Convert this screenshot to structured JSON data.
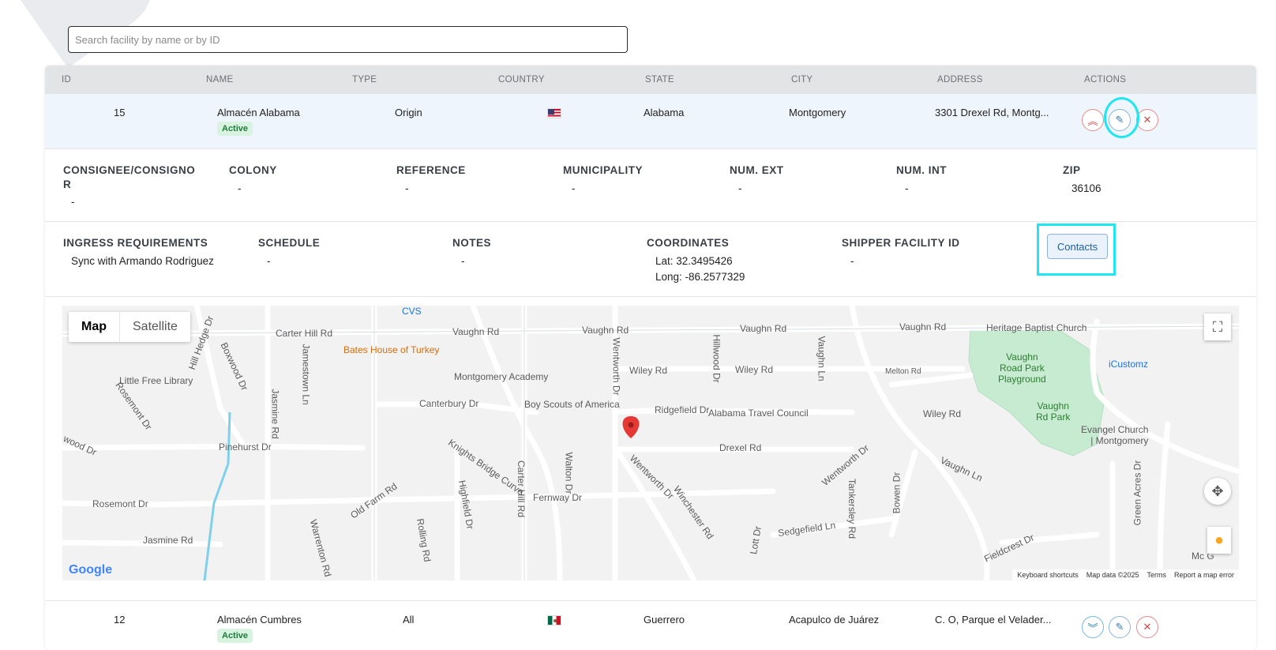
{
  "search": {
    "placeholder": "Search facility by name or by ID"
  },
  "columns": [
    "ID",
    "NAME",
    "TYPE",
    "COUNTRY",
    "STATE",
    "CITY",
    "ADDRESS",
    "ACTIONS"
  ],
  "rows": [
    {
      "id": "15",
      "name": "Almacén Alabama",
      "status": "Active",
      "type": "Origin",
      "country_flag": "us-flag",
      "state": "Alabama",
      "city": "Montgomery",
      "address": "3301 Drexel Rd, Montg..."
    },
    {
      "id": "12",
      "name": "Almacén Cumbres",
      "status": "Active",
      "type": "All",
      "country_flag": "mx-flag",
      "state": "Guerrero",
      "city": "Acapulco de Juárez",
      "address": "C. O, Parque el Velader..."
    }
  ],
  "details": {
    "labels1": [
      "CONSIGNEE/CONSIGNO",
      "R",
      "COLONY",
      "REFERENCE",
      "MUNICIPALITY",
      "NUM. EXT",
      "NUM. INT",
      "ZIP"
    ],
    "values1": [
      "-",
      "-",
      "-",
      "-",
      "-",
      "-",
      "36106"
    ],
    "labels2": [
      "INGRESS REQUIREMENTS",
      "SCHEDULE",
      "NOTES",
      "COORDINATES",
      "SHIPPER FACILITY ID"
    ],
    "ingress": "Sync with Armando Rodriguez",
    "schedule": "-",
    "notes": "-",
    "lat": "Lat: 32.3495426",
    "long": "Long: -86.2577329",
    "shipper_id": "-",
    "contacts_label": "Contacts"
  },
  "map": {
    "toggle": [
      "Map",
      "Satellite"
    ],
    "labels": {
      "cvs": "CVS",
      "carter_hill_rd": "Carter Hill Rd",
      "vaughn_rd_1": "Vaughn Rd",
      "vaughn_rd_2": "Vaughn Rd",
      "vaughn_rd_3": "Vaughn Rd",
      "vaughn_rd_4": "Vaughn Rd",
      "heritage": "Heritage Baptist Church",
      "bates": "Bates House of Turkey",
      "montgomery_academy": "Montgomery Academy",
      "little_free_library": "Little Free Library",
      "wiley_rd_1": "Wiley Rd",
      "wiley_rd_2": "Wiley Rd",
      "wiley_rd_3": "Wiley Rd",
      "melton_rd": "Melton Rd",
      "vaughn_park_1": "Vaughn",
      "vaughn_park_2": "Road Park",
      "vaughn_park_3": "Playground",
      "icustomz": "iCustomz",
      "canterbury_dr": "Canterbury Dr",
      "boy_scouts": "Boy Scouts of America",
      "ridgefield": "Ridgefield Dr",
      "alabama_travel": "Alabama Travel Council",
      "vaughn_rd_park_1": "Vaughn",
      "vaughn_rd_park_2": "Rd Park",
      "evangel_1": "Evangel Church",
      "evangel_2": "| Montgomery",
      "pinehurst": "Pinehurst Dr",
      "drexel": "Drexel Rd",
      "knights_bridge": "Knights Bridge Curve",
      "rosemont_dr": "Rosemont Dr",
      "fernway": "Fernway Dr",
      "sedgefield": "Sedgefield Ln",
      "fieldcrest": "Fieldcrest Dr",
      "jasmine_rd": "Jasmine Rd",
      "old_farm": "Old Farm Rd",
      "wentworth": "Wentworth Dr",
      "winchester": "Winchester Rd",
      "rosemont_vertical": "Rosemont Dr",
      "hill_hedge": "Hill Hedge Dr",
      "boxwood": "Boxwood Dr",
      "jamestown": "Jamestown Ln",
      "jasmine_vert": "Jasmine Rd",
      "highfield": "Highfield Dr",
      "carter_vert": "Carter Hill Rd",
      "walton": "Walton Dr",
      "wentworth_vert": "Wentworth Dr",
      "hillwood": "Hillwood Dr",
      "vaughn_ln": "Vaughn Ln",
      "vaughn_ln_2": "Vaughn Ln",
      "tankersley": "Tankersley Rd",
      "bowen": "Bowen Dr",
      "green_acres": "Green Acres Dr",
      "lott": "Lott Dr",
      "rolling": "Rolling Rd",
      "warrenton": "Warrenton Rd",
      "wood_dr": "wood Dr",
      "wentworth_dr_2": "Wentworth Dr",
      "mc": "Mc G"
    },
    "footer": [
      "Keyboard shortcuts",
      "Map data ©2025",
      "Terms",
      "Report a map error"
    ],
    "brand": "Google"
  },
  "colors": {
    "focus": "#1fe6f0",
    "active_bg": "#d9f3e1",
    "row_hover": "#eef5fc",
    "park": "#c6ebd0",
    "pin": "#e53935"
  }
}
